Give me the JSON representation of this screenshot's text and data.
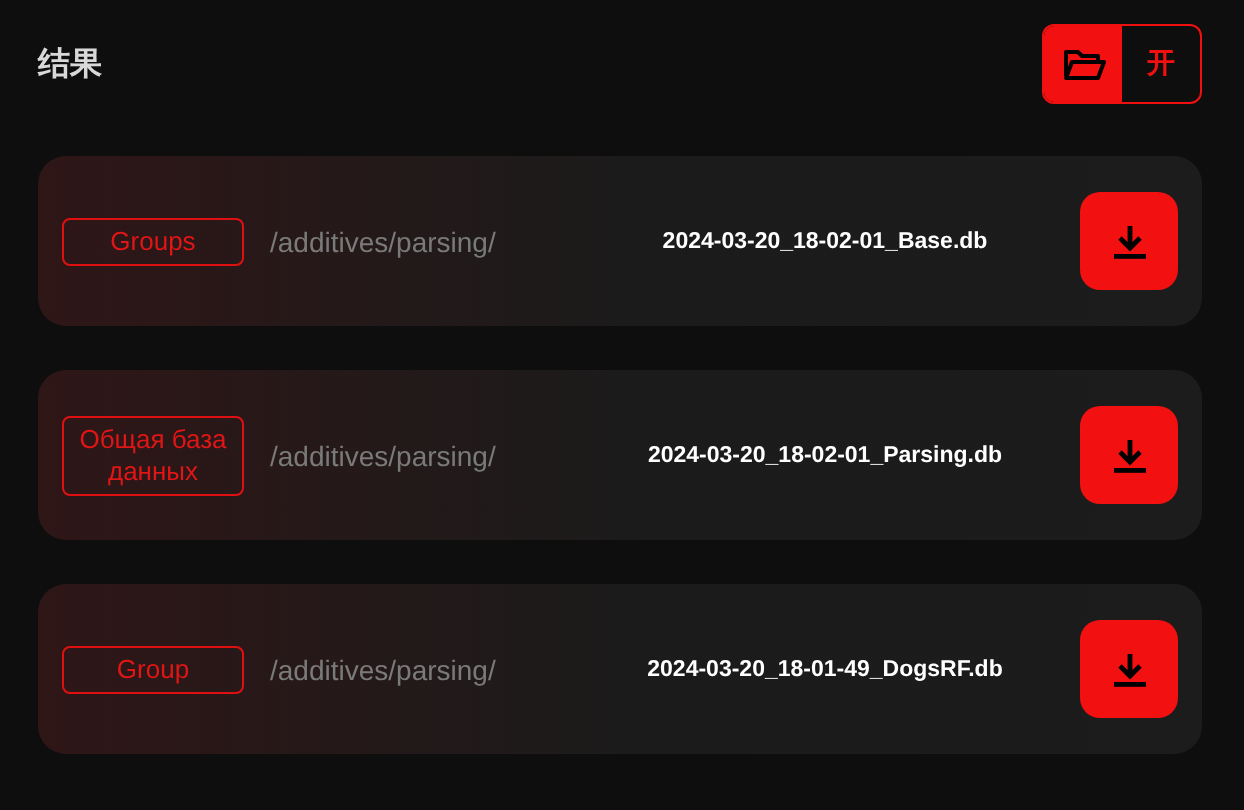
{
  "header": {
    "title": "结果"
  },
  "view_toggle": [
    {
      "kind": "icon",
      "selected": true
    },
    {
      "kind": "text",
      "label": "开",
      "selected": false
    }
  ],
  "results": [
    {
      "tag": "Groups",
      "path": "/additives/parsing/",
      "file": "2024-03-20_18-02-01_Base.db"
    },
    {
      "tag": "Общая база данных",
      "path": "/additives/parsing/",
      "file": "2024-03-20_18-02-01_Parsing.db"
    },
    {
      "tag": "Group",
      "path": "/additives/parsing/",
      "file": "2024-03-20_18-01-49_DogsRF.db"
    }
  ]
}
